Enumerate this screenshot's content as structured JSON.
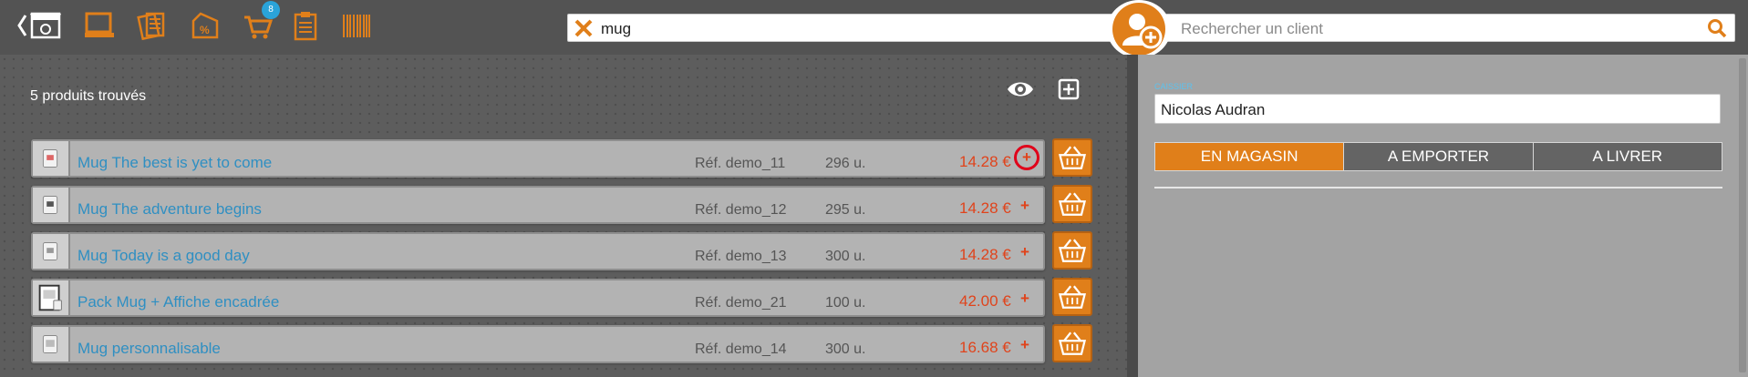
{
  "toolbar": {
    "icons": [
      "back-store-icon",
      "monitor-icon",
      "catalog-icon",
      "discount-icon",
      "cart-icon",
      "clipboard-icon",
      "barcode-icon"
    ],
    "cart_badge": "8",
    "accent_color": "#e07f1a"
  },
  "search": {
    "value": "mug"
  },
  "client_search": {
    "placeholder": "Rechercher un client"
  },
  "results": {
    "count_label": "5 produits trouvés",
    "products": [
      {
        "name": "Mug The best is yet to come",
        "ref": "Réf. demo_11",
        "qty": "296 u.",
        "price": "14.28 €"
      },
      {
        "name": "Mug The adventure begins",
        "ref": "Réf. demo_12",
        "qty": "295 u.",
        "price": "14.28 €"
      },
      {
        "name": "Mug Today is a good day",
        "ref": "Réf. demo_13",
        "qty": "300 u.",
        "price": "14.28 €"
      },
      {
        "name": "Pack Mug + Affiche encadrée",
        "ref": "Réf. demo_21",
        "qty": "100 u.",
        "price": "42.00 €"
      },
      {
        "name": "Mug personnalisable",
        "ref": "Réf. demo_14",
        "qty": "300 u.",
        "price": "16.68 €"
      }
    ],
    "plus_symbol": "+"
  },
  "cart_panel": {
    "cashier_label": "CAISSIER",
    "cashier_value": "Nicolas Audran",
    "modes": [
      {
        "label": "EN MAGASIN",
        "active": true
      },
      {
        "label": "A EMPORTER",
        "active": false
      },
      {
        "label": "A LIVRER",
        "active": false
      }
    ]
  }
}
